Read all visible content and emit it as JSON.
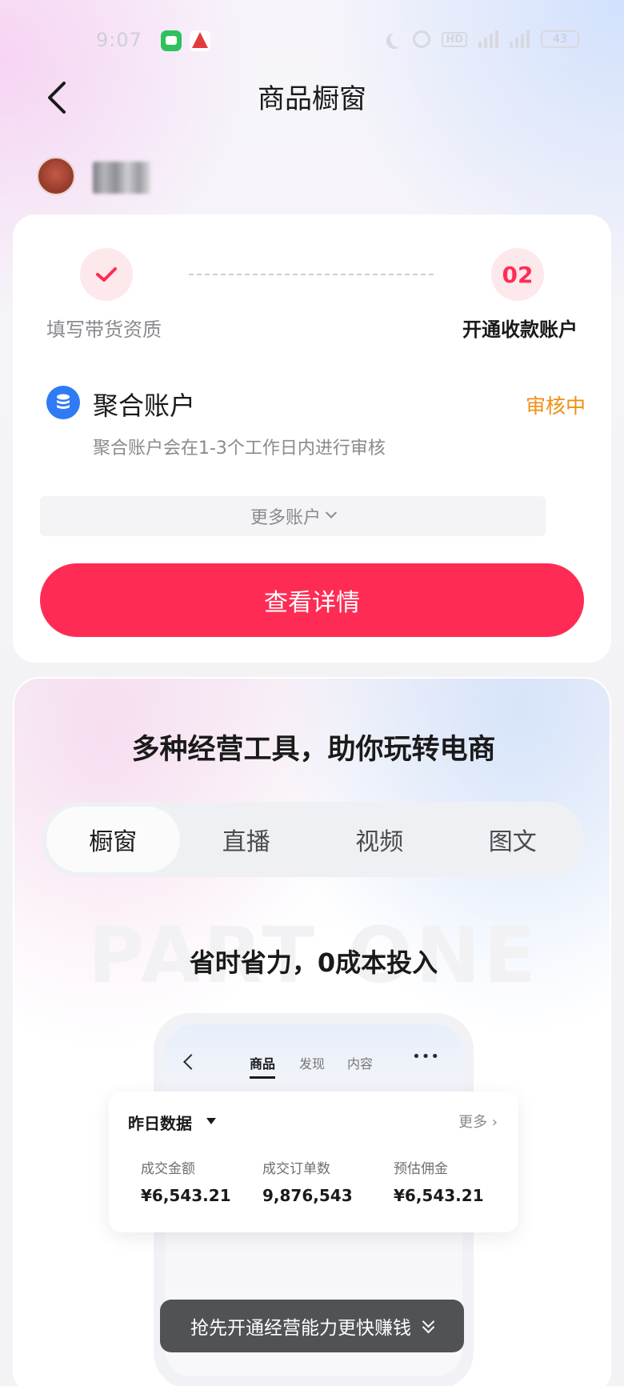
{
  "status_bar": {
    "time": "9:07",
    "battery": "43",
    "hd": "HD"
  },
  "header": {
    "title": "商品橱窗"
  },
  "steps": [
    {
      "label": "填写带货资质",
      "state": "done"
    },
    {
      "number": "02",
      "label": "开通收款账户",
      "state": "current"
    }
  ],
  "account": {
    "title": "聚合账户",
    "status": "审核中",
    "description": "聚合账户会在1-3个工作日内进行审核",
    "more_label": "更多账户"
  },
  "actions": {
    "view_details": "查看详情"
  },
  "tools": {
    "heading": "多种经营工具，助你玩转电商",
    "tabs": [
      "橱窗",
      "直播",
      "视频",
      "图文"
    ],
    "active_tab": 0,
    "watermark": "PART ONE",
    "part_title": "省时省力，0成本投入"
  },
  "phone_preview": {
    "tabs": [
      "商品",
      "发现",
      "内容"
    ],
    "active_tab": 0,
    "stats_title": "昨日数据",
    "more": "更多",
    "metrics": [
      {
        "label": "成交金额",
        "value": "¥6,543.21"
      },
      {
        "label": "成交订单数",
        "value": "9,876,543"
      },
      {
        "label": "预估佣金",
        "value": "¥6,543.21"
      }
    ]
  },
  "toast": {
    "text": "抢先开通经营能力更快赚钱"
  },
  "colors": {
    "accent": "#fe2c55",
    "status_pending": "#ef8f14",
    "account_icon": "#2f7bf5"
  }
}
